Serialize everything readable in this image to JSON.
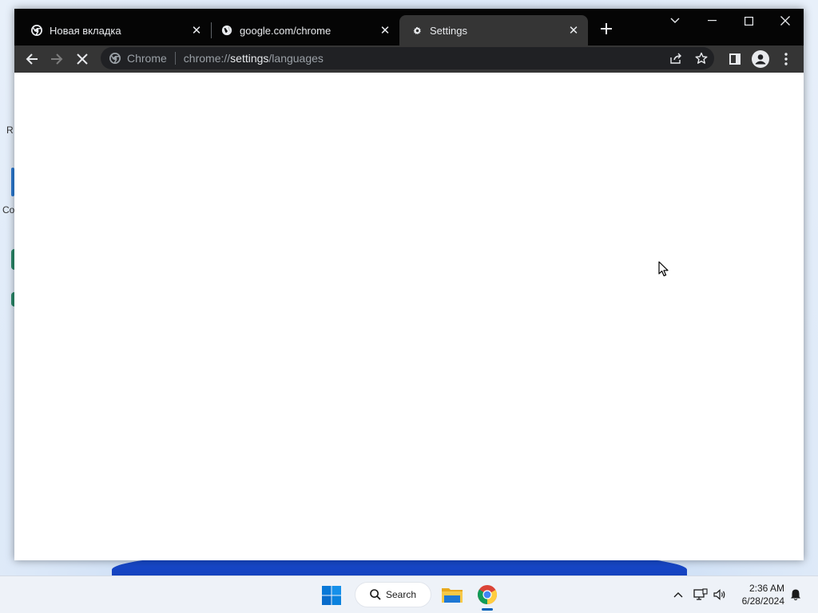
{
  "browser": {
    "tabs": [
      {
        "title": "Новая вкладка",
        "favicon": "chrome-logo-icon",
        "active": false
      },
      {
        "title": "google.com/chrome",
        "favicon": "globe-icon",
        "active": false
      },
      {
        "title": "Settings",
        "favicon": "gear-icon",
        "active": true
      }
    ],
    "omnibox": {
      "site_label": "Chrome",
      "url_scheme": "chrome://",
      "url_host": "settings",
      "url_path": "/languages"
    },
    "page_state": "loading"
  },
  "taskbar": {
    "search_label": "Search",
    "pinned_apps": [
      "file-explorer-icon",
      "chrome-icon"
    ],
    "clock": {
      "time": "2:36 AM",
      "date": "6/28/2024"
    }
  },
  "colors": {
    "titlebar": "#050505",
    "toolbar": "#353535",
    "active_tab": "#353535",
    "omnibox": "#202124",
    "taskbar": "#eef2f8",
    "accent": "#005fb8"
  }
}
